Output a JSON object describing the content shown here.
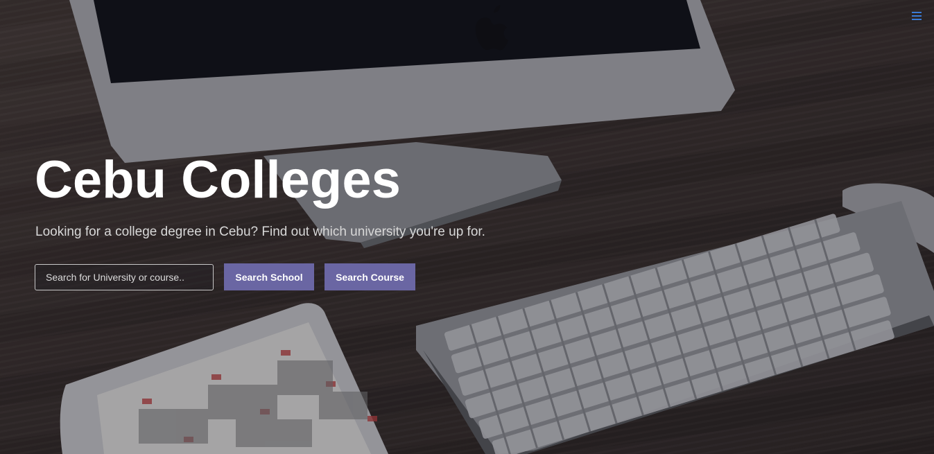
{
  "page": {
    "title": "Cebu Colleges",
    "subtitle": "Looking for a college degree in Cebu? Find out which university you're up for."
  },
  "nav": {
    "menu_icon": "hamburger-menu-icon"
  },
  "search": {
    "placeholder": "Search for University or course..",
    "value": "",
    "school_button_label": "Search School",
    "course_button_label": "Search Course"
  },
  "colors": {
    "accent": "#6a66a3",
    "menu_icon": "#3a7bd5",
    "title": "#ffffff"
  }
}
